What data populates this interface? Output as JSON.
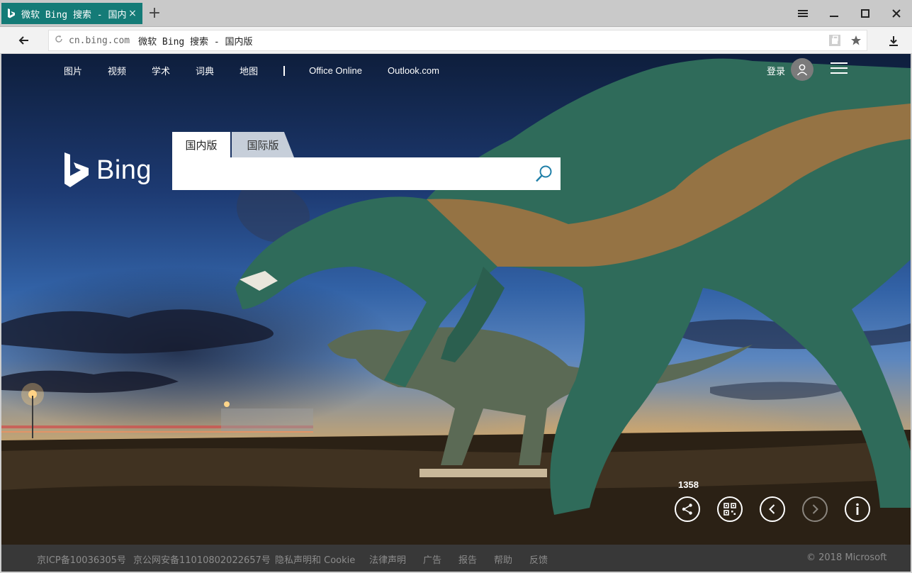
{
  "browser": {
    "tab_title": "微软 Bing 搜索 - 国内版",
    "tab_close": "×",
    "new_tab": "+",
    "address_domain": "cn.bing.com",
    "address_title": "微软 Bing 搜索 - 国内版"
  },
  "nav": {
    "links": [
      "图片",
      "视频",
      "学术",
      "词典",
      "地图"
    ],
    "links2": [
      "Office Online",
      "Outlook.com"
    ],
    "login": "登录"
  },
  "logo": {
    "wordmark": "Bing"
  },
  "search": {
    "tabs": [
      "国内版",
      "国际版"
    ],
    "value": ""
  },
  "controls": {
    "count": "1358"
  },
  "footer": {
    "items": [
      "京ICP备10036305号",
      "京公网安备11010802022657号",
      "隐私声明和 Cookie",
      "法律声明",
      "广告",
      "报告",
      "帮助",
      "反馈"
    ],
    "copyright": "© 2018 Microsoft"
  },
  "colors": {
    "tab_active": "#147b77",
    "search_icon": "#1f7fa8"
  }
}
